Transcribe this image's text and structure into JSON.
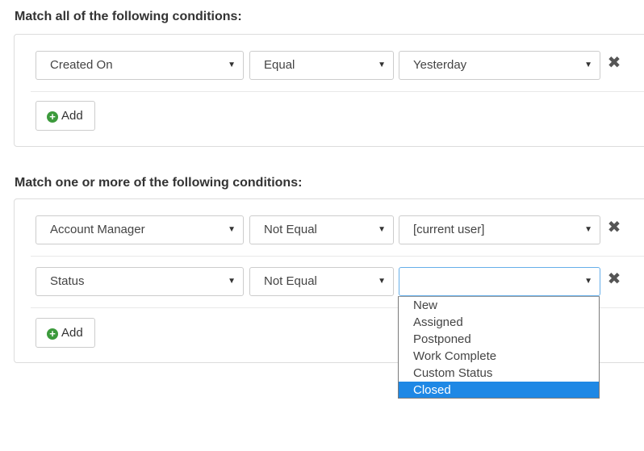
{
  "group_all": {
    "title": "Match all of the following conditions:",
    "conditions": [
      {
        "field": "Created On",
        "operator": "Equal",
        "value": "Yesterday"
      }
    ],
    "add_label": "Add"
  },
  "group_any": {
    "title": "Match one or more of the following conditions:",
    "conditions": [
      {
        "field": "Account Manager",
        "operator": "Not Equal",
        "value": "[current user]"
      },
      {
        "field": "Status",
        "operator": "Not Equal",
        "value": ""
      }
    ],
    "add_label": "Add"
  },
  "status_dropdown": {
    "options": [
      "New",
      "Assigned",
      "Postponed",
      "Work Complete",
      "Custom Status",
      "Closed"
    ],
    "highlighted": "Closed"
  },
  "icons": {
    "remove": "close-icon",
    "add": "plus-circle-icon",
    "caret": "caret-down-icon"
  },
  "colors": {
    "highlight": "#1e88e5",
    "add_icon": "#3c9a3c",
    "focus_border": "#66afe9"
  }
}
